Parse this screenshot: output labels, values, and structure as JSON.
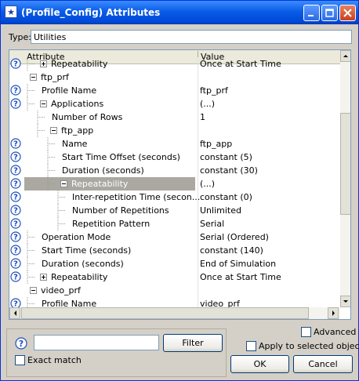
{
  "window": {
    "title": "(Profile_Config) Attributes",
    "icon": "star-icon"
  },
  "type_field": {
    "label": "Type:",
    "value": "Utilities"
  },
  "columns": {
    "attribute": "Attribute",
    "value": "Value"
  },
  "rows": [
    {
      "name": "Repeatability",
      "value": "Once at Start Time",
      "help": true,
      "expander": "plus",
      "level": 2,
      "partial": true
    },
    {
      "name": "ftp_prf",
      "value": "",
      "help": false,
      "expander": "minus",
      "level": 1
    },
    {
      "name": "Profile Name",
      "value": "ftp_prf",
      "help": true,
      "expander": "",
      "level": 2
    },
    {
      "name": "Applications",
      "value": "(...)",
      "help": true,
      "expander": "minus",
      "level": 2
    },
    {
      "name": "Number of Rows",
      "value": "1",
      "help": false,
      "expander": "",
      "level": 3
    },
    {
      "name": "ftp_app",
      "value": "",
      "help": false,
      "expander": "minus",
      "level": 3
    },
    {
      "name": "Name",
      "value": "ftp_app",
      "help": true,
      "expander": "",
      "level": 4
    },
    {
      "name": "Start Time Offset (seconds)",
      "value": "constant (5)",
      "help": true,
      "expander": "",
      "level": 4
    },
    {
      "name": "Duration (seconds)",
      "value": "constant (30)",
      "help": true,
      "expander": "",
      "level": 4
    },
    {
      "name": "Repeatability",
      "value": "(...)",
      "help": true,
      "expander": "minus",
      "level": 4,
      "selected": true
    },
    {
      "name": "Inter-repetition Time (secon...",
      "value": "constant (0)",
      "help": true,
      "expander": "",
      "level": 5
    },
    {
      "name": "Number of Repetitions",
      "value": "Unlimited",
      "help": true,
      "expander": "",
      "level": 5
    },
    {
      "name": "Repetition Pattern",
      "value": "Serial",
      "help": true,
      "expander": "",
      "level": 5
    },
    {
      "name": "Operation Mode",
      "value": "Serial (Ordered)",
      "help": true,
      "expander": "",
      "level": 2
    },
    {
      "name": "Start Time (seconds)",
      "value": "constant (140)",
      "help": true,
      "expander": "",
      "level": 2
    },
    {
      "name": "Duration (seconds)",
      "value": "End of Simulation",
      "help": true,
      "expander": "",
      "level": 2
    },
    {
      "name": "Repeatability",
      "value": "Once at Start Time",
      "help": true,
      "expander": "plus",
      "level": 2
    },
    {
      "name": "video_prf",
      "value": "",
      "help": false,
      "expander": "minus",
      "level": 1
    },
    {
      "name": "Profile Name",
      "value": "video_prf",
      "help": true,
      "expander": "",
      "level": 2,
      "partial": true
    }
  ],
  "search": {
    "value": "",
    "filter_label": "Filter",
    "exact_match_label": "Exact match",
    "exact_match_checked": false
  },
  "options": {
    "advanced_label": "Advanced",
    "advanced_checked": false,
    "apply_label": "Apply to selected objects",
    "apply_checked": false
  },
  "buttons": {
    "ok_label": "OK",
    "cancel_label": "Cancel"
  },
  "colors": {
    "title_bar": "#0a5ce6",
    "selection": "#aaa8a0",
    "help_icon": "#1f4fbf"
  }
}
